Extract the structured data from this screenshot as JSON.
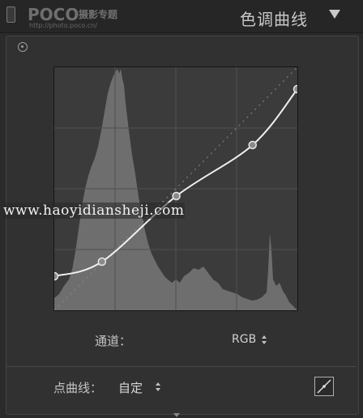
{
  "header": {
    "logo": "POCO",
    "logo_subtitle": "摄影专题",
    "logo_url": "http://photo.poco.cn/",
    "title": "色调曲线",
    "collapse_icon": "triangle-down-icon"
  },
  "curve_editor": {
    "target_icon": "target-adjust-icon",
    "curve_points": [
      {
        "input": 0,
        "output": 14
      },
      {
        "input": 50,
        "output": 20
      },
      {
        "input": 128,
        "output": 47
      },
      {
        "input": 208,
        "output": 68
      },
      {
        "input": 255,
        "output": 91
      }
    ],
    "curve_points_unit": "input 0-255, output as percent of curve height",
    "grid": true,
    "diagonal_reference": true
  },
  "watermark": "www.haoyidiansheji.com",
  "channel": {
    "label": "通道：",
    "value": "RGB"
  },
  "point_curve": {
    "label": "点曲线：",
    "value": "自定",
    "edit_icon": "edit-point-curve-icon"
  },
  "colors": {
    "panel_bg": "#313131",
    "curve_bg": "#3b3b3b",
    "histogram": "#6e6e6e",
    "curve_line": "#f0f0f0"
  }
}
